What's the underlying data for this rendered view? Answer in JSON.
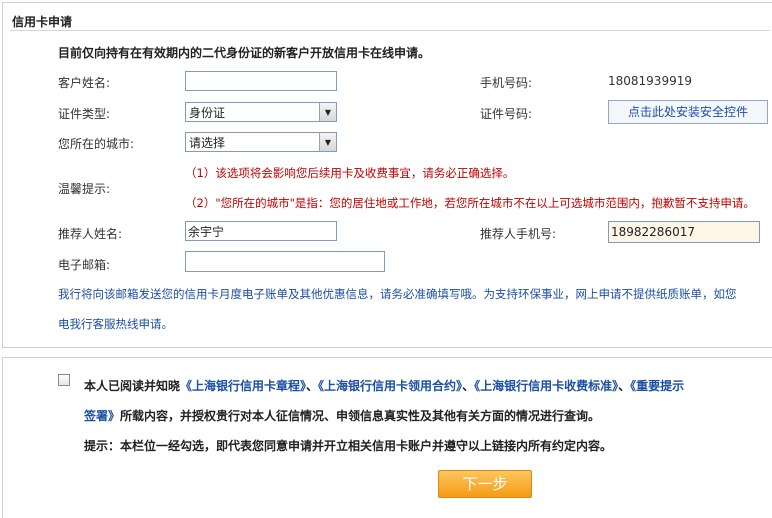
{
  "section_title": "信用卡申请",
  "notice": "目前仅向持有在有效期内的二代身份证的新客户开放信用卡在线申请。",
  "fields": {
    "name_label": "客户姓名:",
    "name_value": "",
    "phone_label": "手机号码:",
    "phone_value": "18081939919",
    "id_type_label": "证件类型:",
    "id_type_value": "身份证",
    "id_number_label": "证件号码:",
    "install_control_button": "点击此处安装安全控件",
    "city_label": "您所在的城市:",
    "city_value": "请选择",
    "tips_label": "温馨提示:",
    "tip1": "（1）该选项将会影响您后续用卡及收费事宜，请务必正确选择。",
    "tip2": "（2）\"您所在的城市\"是指：您的居住地或工作地，若您所在城市不在以上可选城市范围内，抱歉暂不支持申请。",
    "referrer_name_label": "推荐人姓名:",
    "referrer_name_value": "余宇宁",
    "referrer_phone_label": "推荐人手机号:",
    "referrer_phone_value": "18982286017",
    "email_label": "电子邮箱:",
    "email_value": "",
    "email_note_line1": "我行将向该邮箱发送您的信用卡月度电子账单及其他优惠信息，请务必准确填写哦。为支持环保事业，网上申请不提供纸质账单，如您",
    "email_note_line2": "电我行客服热线申请。"
  },
  "agreement": {
    "prefix": "本人已阅读并知晓",
    "link1": "《上海银行信用卡章程》",
    "sep1": "、",
    "link2": "《上海银行信用卡领用合约》",
    "sep2": "、",
    "link3": "《上海银行信用卡收费标准》",
    "sep3": "、",
    "link4": "《重要提示",
    "line2_link": "签署》",
    "line2_text": "所载内容，并授权贵行对本人征信情况、申领信息真实性及其他有关方面的情况进行查询。",
    "hint": "提示：本栏位一经勾选，即代表您同意申请并开立相关信用卡账户并遵守以上链接内所有约定内容。",
    "checked": false
  },
  "next_button": "下一步"
}
